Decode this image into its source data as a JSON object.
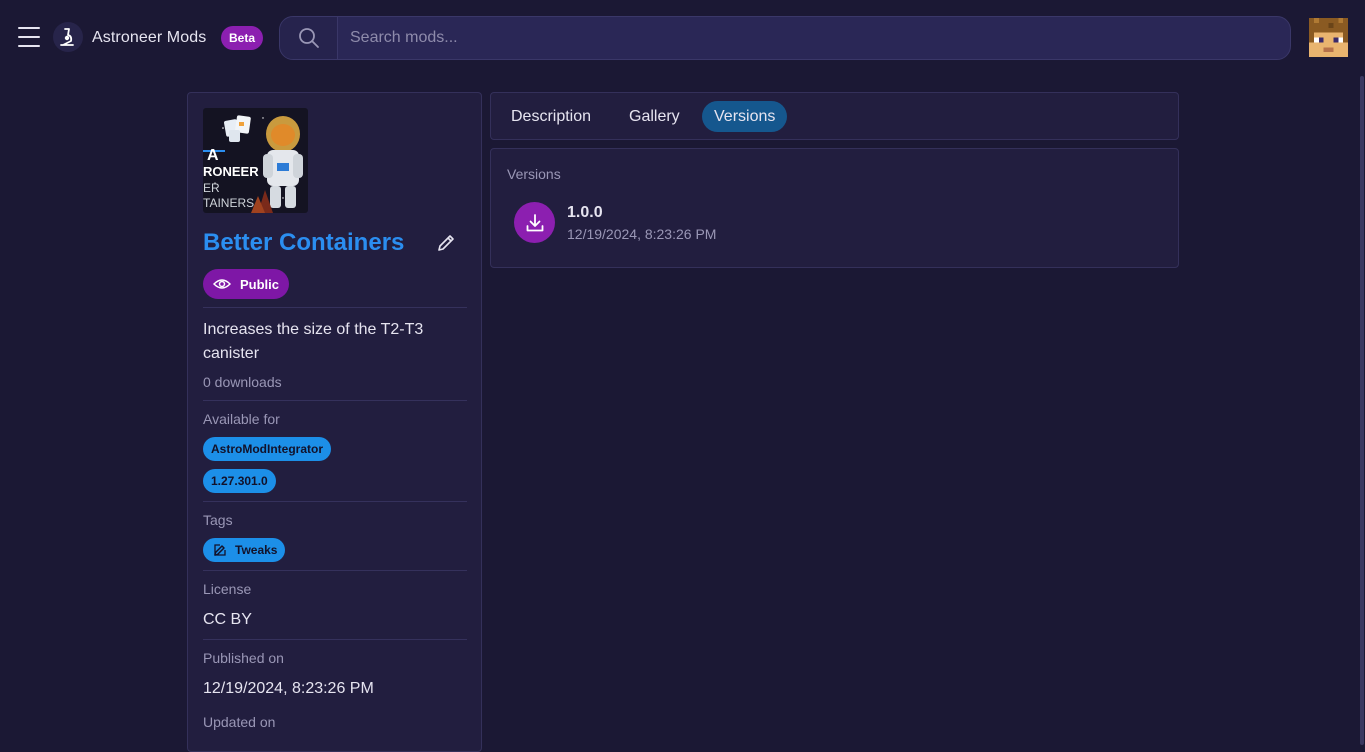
{
  "header": {
    "app_title": "Astroneer Mods",
    "beta_label": "Beta",
    "search_placeholder": "Search mods..."
  },
  "mod": {
    "title": "Better Containers",
    "visibility": "Public",
    "description": "Increases the size of the T2-T3 canister",
    "downloads": "0 downloads",
    "thumbnail_text": [
      "A",
      "RONEER",
      "ER",
      "TAINERS"
    ],
    "available_for_label": "Available for",
    "available_for": [
      "AstroModIntegrator",
      "1.27.301.0"
    ],
    "tags_label": "Tags",
    "tags": [
      "Tweaks"
    ],
    "license_label": "License",
    "license": "CC BY",
    "published_label": "Published on",
    "published": "12/19/2024, 8:23:26 PM",
    "updated_label": "Updated on"
  },
  "tabs": [
    {
      "label": "Description",
      "active": false
    },
    {
      "label": "Gallery",
      "active": false
    },
    {
      "label": "Versions",
      "active": true
    }
  ],
  "versions": {
    "heading": "Versions",
    "items": [
      {
        "version": "1.0.0",
        "date": "12/19/2024, 8:23:26 PM"
      }
    ]
  },
  "colors": {
    "background": "#1b1834",
    "card": "#221e3f",
    "accent_purple": "#8c1fb0",
    "accent_blue": "#2b8ef0",
    "tab_active": "#15578e",
    "chip_blue": "#1c8fe8"
  }
}
